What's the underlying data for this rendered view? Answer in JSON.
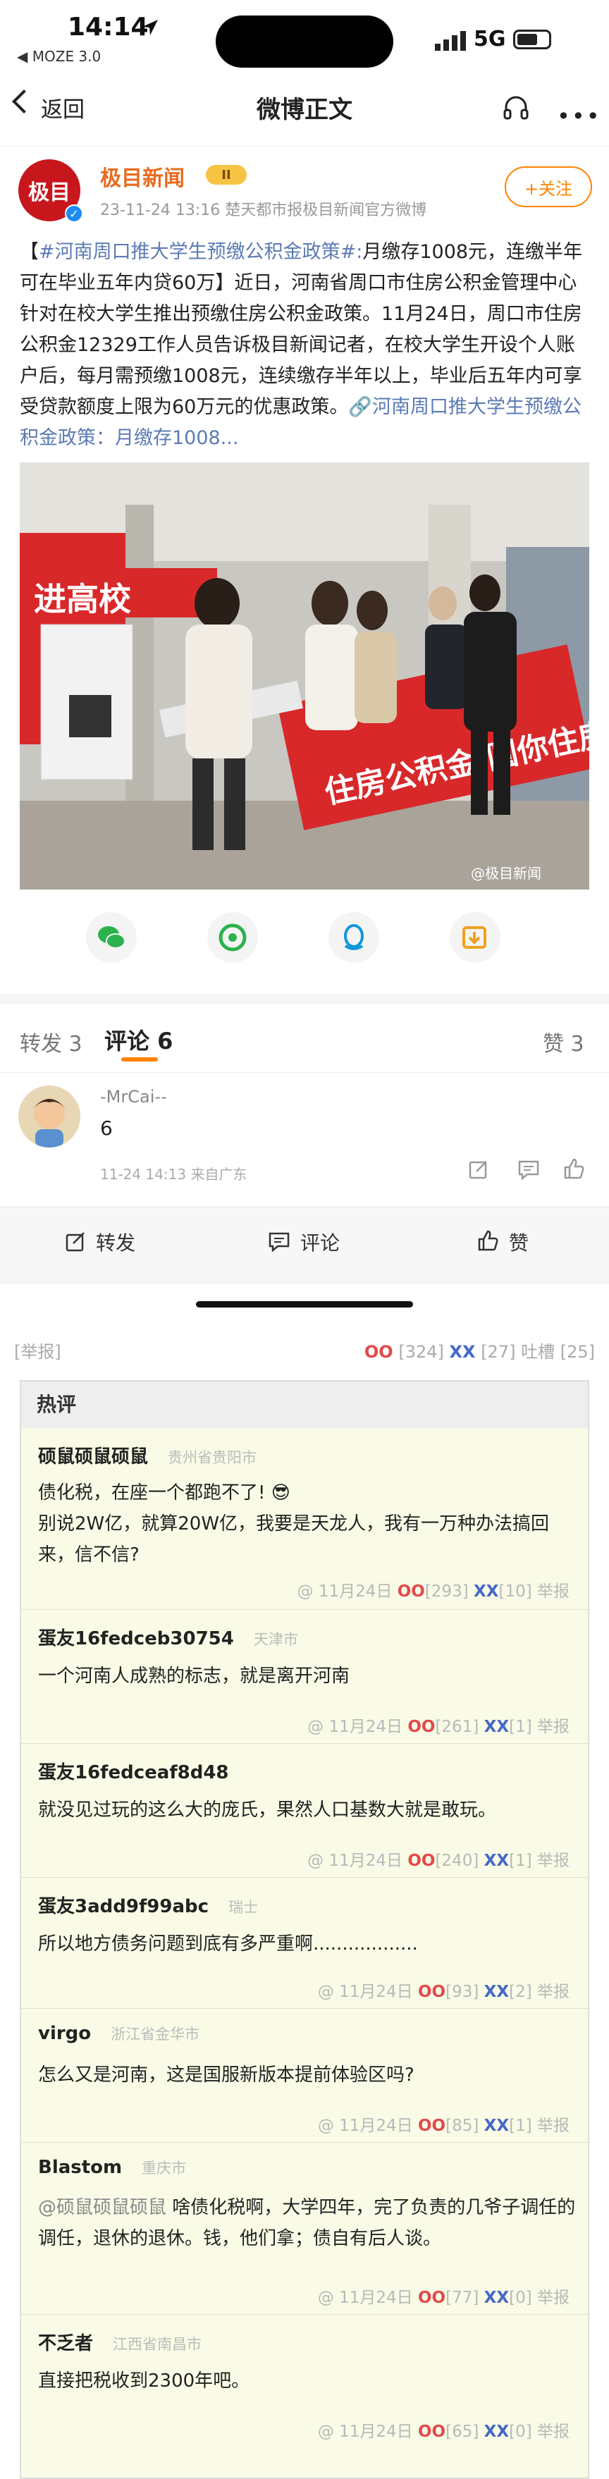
{
  "status": {
    "time": "14:14",
    "carrier": "◀ MOZE 3.0",
    "network": "5G"
  },
  "nav": {
    "back": "返回",
    "title": "微博正文"
  },
  "post": {
    "author": "极目新闻",
    "avatar_text": "极目",
    "vip": "II",
    "time": "23-11-24 13:16",
    "source": "楚天都市报极目新闻官方微博",
    "follow": "+关注",
    "topic": "#河南周口推大学生预缴公积金政策#:",
    "text": "月缴存1008元，连缴半年可在毕业五年内贷60万】近日，河南省周口市住房公积金管理中心针对在校大学生推出预缴住房公积金政策。11月24日，周口市住房公积金12329工作人员告诉极目新闻记者，在校大学生开设个人账户后，每月需预缴1008元，连续缴存半年以上，毕业后五年内可享受贷款额度上限为60万元的优惠政策。",
    "link": "🔗河南周口推大学生预缴公积金政策：月缴存1008...",
    "photo": {
      "banner_left": "进高校",
      "banner_right": "住房公积金 圆你住房梦",
      "watermark": "@极目新闻"
    }
  },
  "tabs": {
    "repost": "转发 3",
    "comments": "评论 6",
    "likes": "赞 3"
  },
  "comment": {
    "user": "-MrCai--",
    "text": "6",
    "meta": "11-24 14:13 来自广东"
  },
  "bottom": {
    "repost": "转发",
    "comment": "评论",
    "like": "赞"
  },
  "report": "[举报]",
  "counts": {
    "oo": "OO",
    "oo_n": "[324]",
    "xx": "XX",
    "xx_n": "[27]",
    "tucao": "吐槽 [25]"
  },
  "hot_title": "热评",
  "hot": [
    {
      "name": "硕鼠硕鼠硕鼠",
      "loc": "贵州省贵阳市",
      "text": "债化税，在座一个都跑不了! 😎",
      "text2": "别说2W亿，就算20W亿，我要是天龙人，我有一万种办法搞回来，信不信?",
      "date": "@ 11月24日",
      "oo": "[293]",
      "xx": "[10]"
    },
    {
      "name": "蛋友16fedceb30754",
      "loc": "天津市",
      "text": "一个河南人成熟的标志，就是离开河南",
      "date": "@ 11月24日",
      "oo": "[261]",
      "xx": "[1]"
    },
    {
      "name": "蛋友16fedceaf8d48",
      "loc": "",
      "text": "就没见过玩的这么大的庞氏，果然人口基数大就是敢玩。",
      "date": "@ 11月24日",
      "oo": "[240]",
      "xx": "[1]"
    },
    {
      "name": "蛋友3add9f99abc",
      "loc": "瑞士",
      "text": "所以地方债务问题到底有多严重啊..................",
      "date": "@ 11月24日",
      "oo": "[93]",
      "xx": "[2]"
    },
    {
      "name": "virgo",
      "loc": "浙江省金华市",
      "text": "怎么又是河南，这是国服新版本提前体验区吗?",
      "date": "@ 11月24日",
      "oo": "[85]",
      "xx": "[1]"
    },
    {
      "name": "Blastom",
      "loc": "重庆市",
      "mention": "@硕鼠硕鼠硕鼠",
      "text": "啥债化税啊，大学四年，完了负责的几爷子调任的调任，退休的退休。钱，他们拿；债自有后人谈。",
      "date": "@ 11月24日",
      "oo": "[77]",
      "xx": "[0]"
    },
    {
      "name": "不乏者",
      "loc": "江西省南昌市",
      "text": "直接把税收到2300年吧。",
      "date": "@ 11月24日",
      "oo": "[65]",
      "xx": "[0]"
    }
  ],
  "report_label": "举报"
}
